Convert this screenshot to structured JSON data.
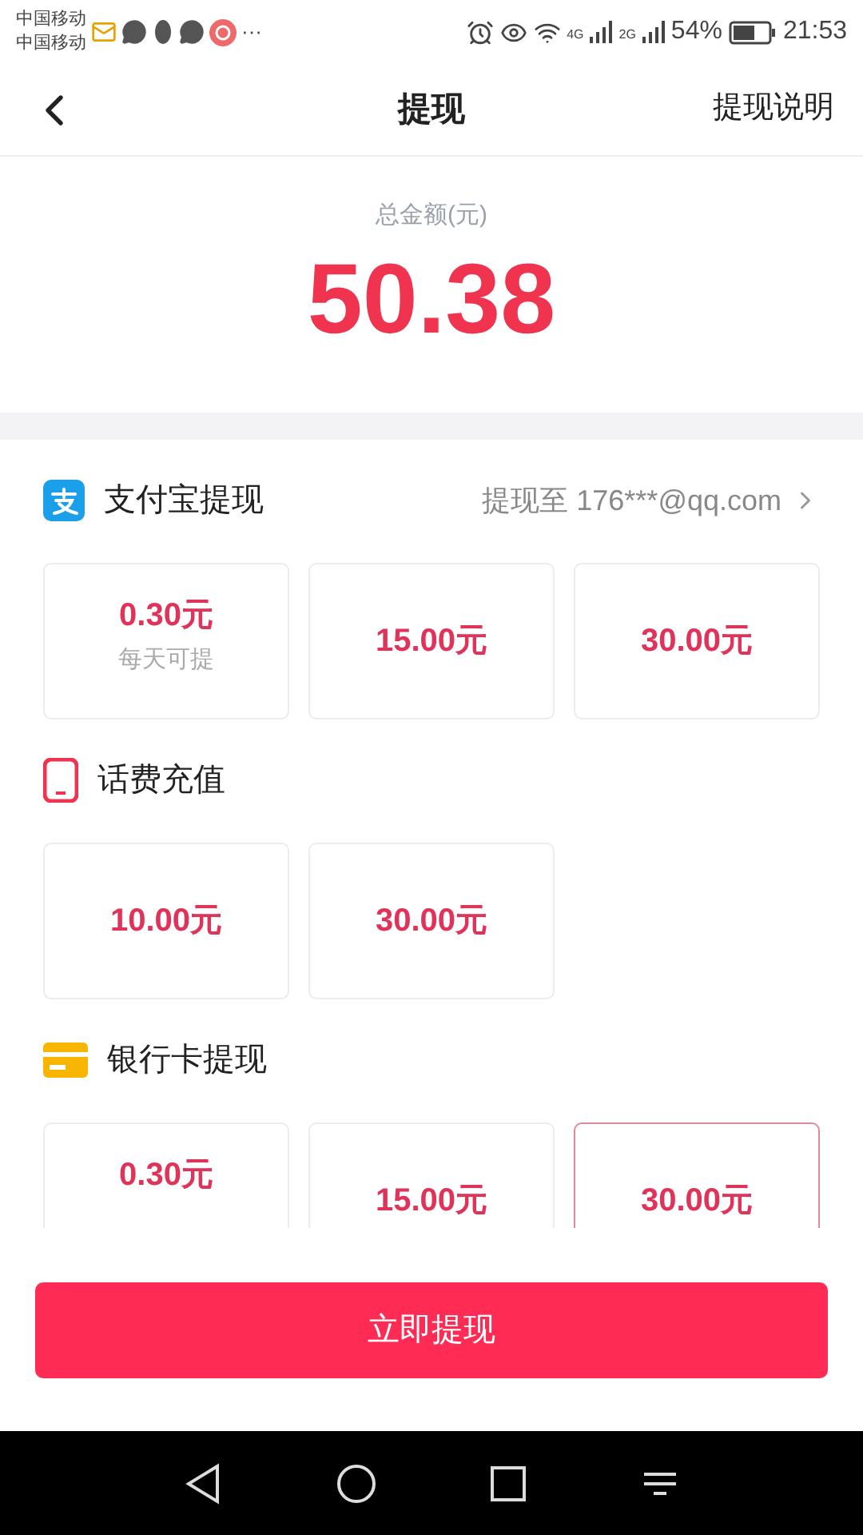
{
  "status_bar": {
    "carriers": [
      "中国移动",
      "中国移动"
    ],
    "more": "···",
    "net1": "4G",
    "net2": "2G",
    "battery": "54%",
    "time": "21:53"
  },
  "header": {
    "title": "提现",
    "action": "提现说明"
  },
  "total": {
    "label": "总金额(元)",
    "amount": "50.38"
  },
  "sections": [
    {
      "kind": "alipay",
      "title": "支付宝提现",
      "account": "提现至 176***@qq.com",
      "options": [
        {
          "amount": "0.30元",
          "daily": true,
          "note": "每天可提",
          "selected": false
        },
        {
          "amount": "15.00元",
          "daily": false,
          "selected": false
        },
        {
          "amount": "30.00元",
          "daily": false,
          "selected": false
        }
      ]
    },
    {
      "kind": "phone",
      "title": "话费充值",
      "options": [
        {
          "amount": "10.00元",
          "daily": false,
          "selected": false
        },
        {
          "amount": "30.00元",
          "daily": false,
          "selected": false
        }
      ]
    },
    {
      "kind": "bank",
      "title": "银行卡提现",
      "options": [
        {
          "amount": "0.30元",
          "daily": true,
          "selected": false
        },
        {
          "amount": "15.00元",
          "daily": false,
          "selected": false
        },
        {
          "amount": "30.00元",
          "daily": false,
          "selected": true
        }
      ]
    }
  ],
  "submit": "立即提现"
}
